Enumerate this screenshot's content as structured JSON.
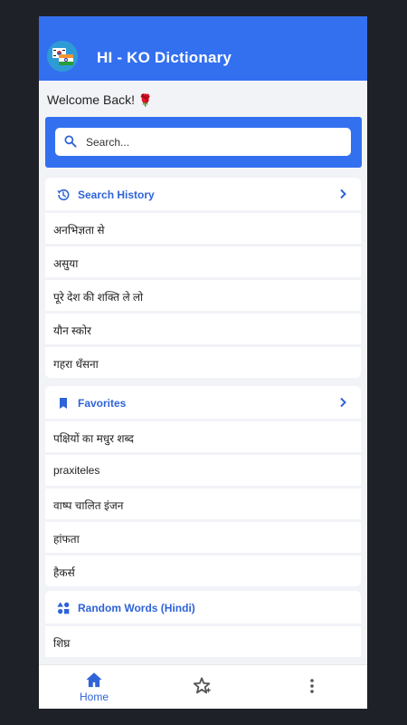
{
  "app": {
    "title": "HI - KO Dictionary",
    "logo_icon": "korean-indian-flags-logo"
  },
  "welcome": {
    "text": "Welcome Back!",
    "emoji": "🌹"
  },
  "search": {
    "placeholder": "Search..."
  },
  "sections": {
    "history": {
      "title": "Search History",
      "icon": "history-icon",
      "items": [
        "अनभिज्ञता से",
        "असुया",
        "पूरे देश की शक्ति ले लो",
        "यौन स्कोर",
        "गहरा धँसना"
      ]
    },
    "favorites": {
      "title": "Favorites",
      "icon": "bookmark-icon",
      "items": [
        "पक्षियों का मधुर शब्द",
        "praxiteles",
        "वाष्प चालित इंजन",
        "हांफता",
        "हैकर्स"
      ]
    },
    "random": {
      "title": "Random Words (Hindi)",
      "icon": "category-shapes-icon",
      "items": [
        "शिघ्र"
      ]
    }
  },
  "bottom_nav": {
    "home_label": "Home",
    "favorites_icon": "star-sparkle-icon",
    "more_icon": "more-vertical-icon"
  },
  "colors": {
    "primary": "#3370f0",
    "accent_text": "#2f63d8",
    "background": "#f2f3f7",
    "frame": "#1f2128"
  }
}
